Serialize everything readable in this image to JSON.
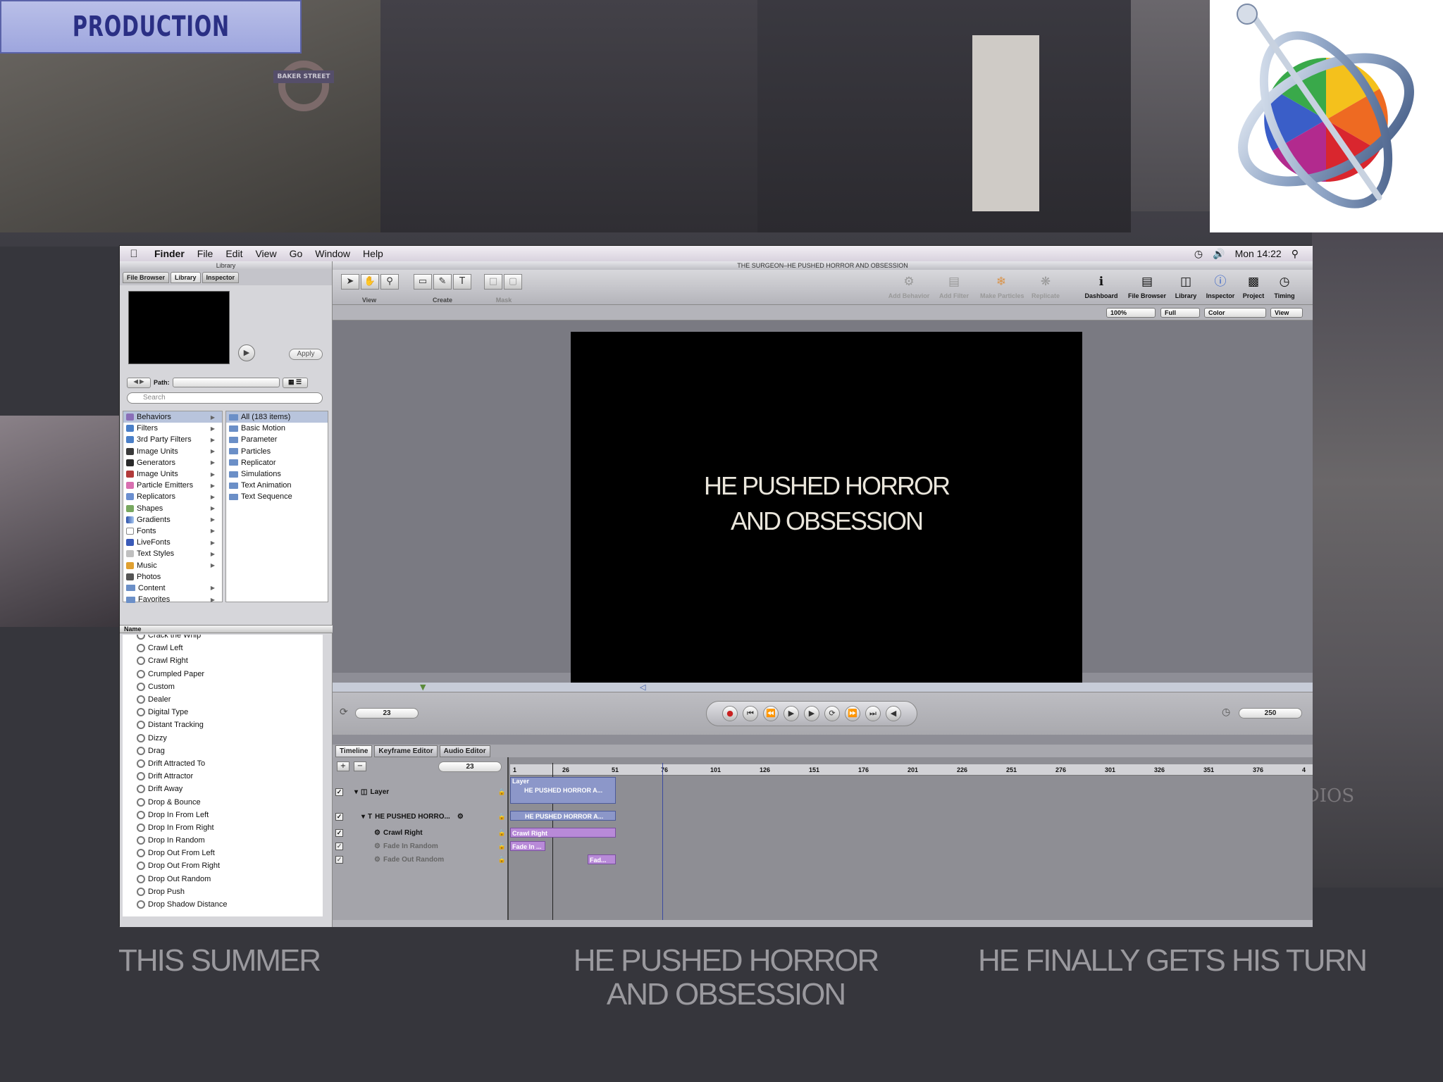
{
  "slide": {
    "heading": "PRODUCTION",
    "captions": [
      "THIS SUMMER",
      "HE PUSHED HORROR\nAND OBSESSION",
      "HE FINALLY GETS HIS TURN"
    ],
    "photo_texts": {
      "underground_sign": "BAKER STREET",
      "right_edge": "UDIOS"
    }
  },
  "menubar": {
    "app": "Finder",
    "items": [
      "File",
      "Edit",
      "View",
      "Go",
      "Window",
      "Help"
    ],
    "clock": "Mon 14:22"
  },
  "library": {
    "title": "Library",
    "tabs": [
      "File Browser",
      "Library",
      "Inspector"
    ],
    "apply": "Apply",
    "path_label": "Path:",
    "search_placeholder": "Search",
    "categories": [
      "Behaviors",
      "Filters",
      "3rd Party Filters",
      "Image Units",
      "Generators",
      "Image Units",
      "Particle Emitters",
      "Replicators",
      "Shapes",
      "Gradients",
      "Fonts",
      "LiveFonts",
      "Text Styles",
      "Music",
      "Photos",
      "Content",
      "Favorites"
    ],
    "subcategories": [
      "All (183 items)",
      "Basic Motion",
      "Parameter",
      "Particles",
      "Replicator",
      "Simulations",
      "Text Animation",
      "Text Sequence"
    ],
    "list_header": "Name",
    "behaviors": [
      "Crack the Whip",
      "Crawl Left",
      "Crawl Right",
      "Crumpled Paper",
      "Custom",
      "Dealer",
      "Digital Type",
      "Distant Tracking",
      "Dizzy",
      "Drag",
      "Drift Attracted To",
      "Drift Attractor",
      "Drift Away",
      "Drop & Bounce",
      "Drop In From Left",
      "Drop In From Right",
      "Drop In Random",
      "Drop Out From Left",
      "Drop Out From Right",
      "Drop Out Random",
      "Drop Push",
      "Drop Shadow Distance"
    ]
  },
  "project": {
    "window_title": "THE SURGEON–HE PUSHED HORROR AND OBSESSION",
    "toolbar_groups": [
      "View",
      "Create",
      "Mask"
    ],
    "toolbar_right": [
      "Add Behavior",
      "Add Filter",
      "Make Particles",
      "Replicate",
      "Dashboard",
      "File Browser",
      "Library",
      "Inspector",
      "Project",
      "Timing"
    ],
    "zoom": "100%",
    "resolution": "Full",
    "channels": "Color",
    "view_menu": "View",
    "canvas_text": "HE PUSHED HORROR\nAND OBSESSION",
    "current_frame": "23",
    "end_frame": "250"
  },
  "timeline": {
    "tabs": [
      "Timeline",
      "Keyframe Editor",
      "Audio Editor"
    ],
    "frame_field": "23",
    "ruler": [
      "1",
      "26",
      "51",
      "76",
      "101",
      "126",
      "151",
      "176",
      "201",
      "226",
      "251",
      "276",
      "301",
      "326",
      "351",
      "376",
      "4"
    ],
    "layers": [
      {
        "name": "Layer",
        "bar": "HE PUSHED HORROR A..."
      },
      {
        "name": "HE PUSHED HORRO...",
        "bar": "HE PUSHED HORROR A..."
      },
      {
        "name": "Crawl Right",
        "bar": "Crawl Right"
      },
      {
        "name": "Fade In Random",
        "bar": "Fade In ..."
      },
      {
        "name": "Fade Out Random",
        "bar": "Fad..."
      }
    ],
    "layer_bar_label": "Layer"
  }
}
